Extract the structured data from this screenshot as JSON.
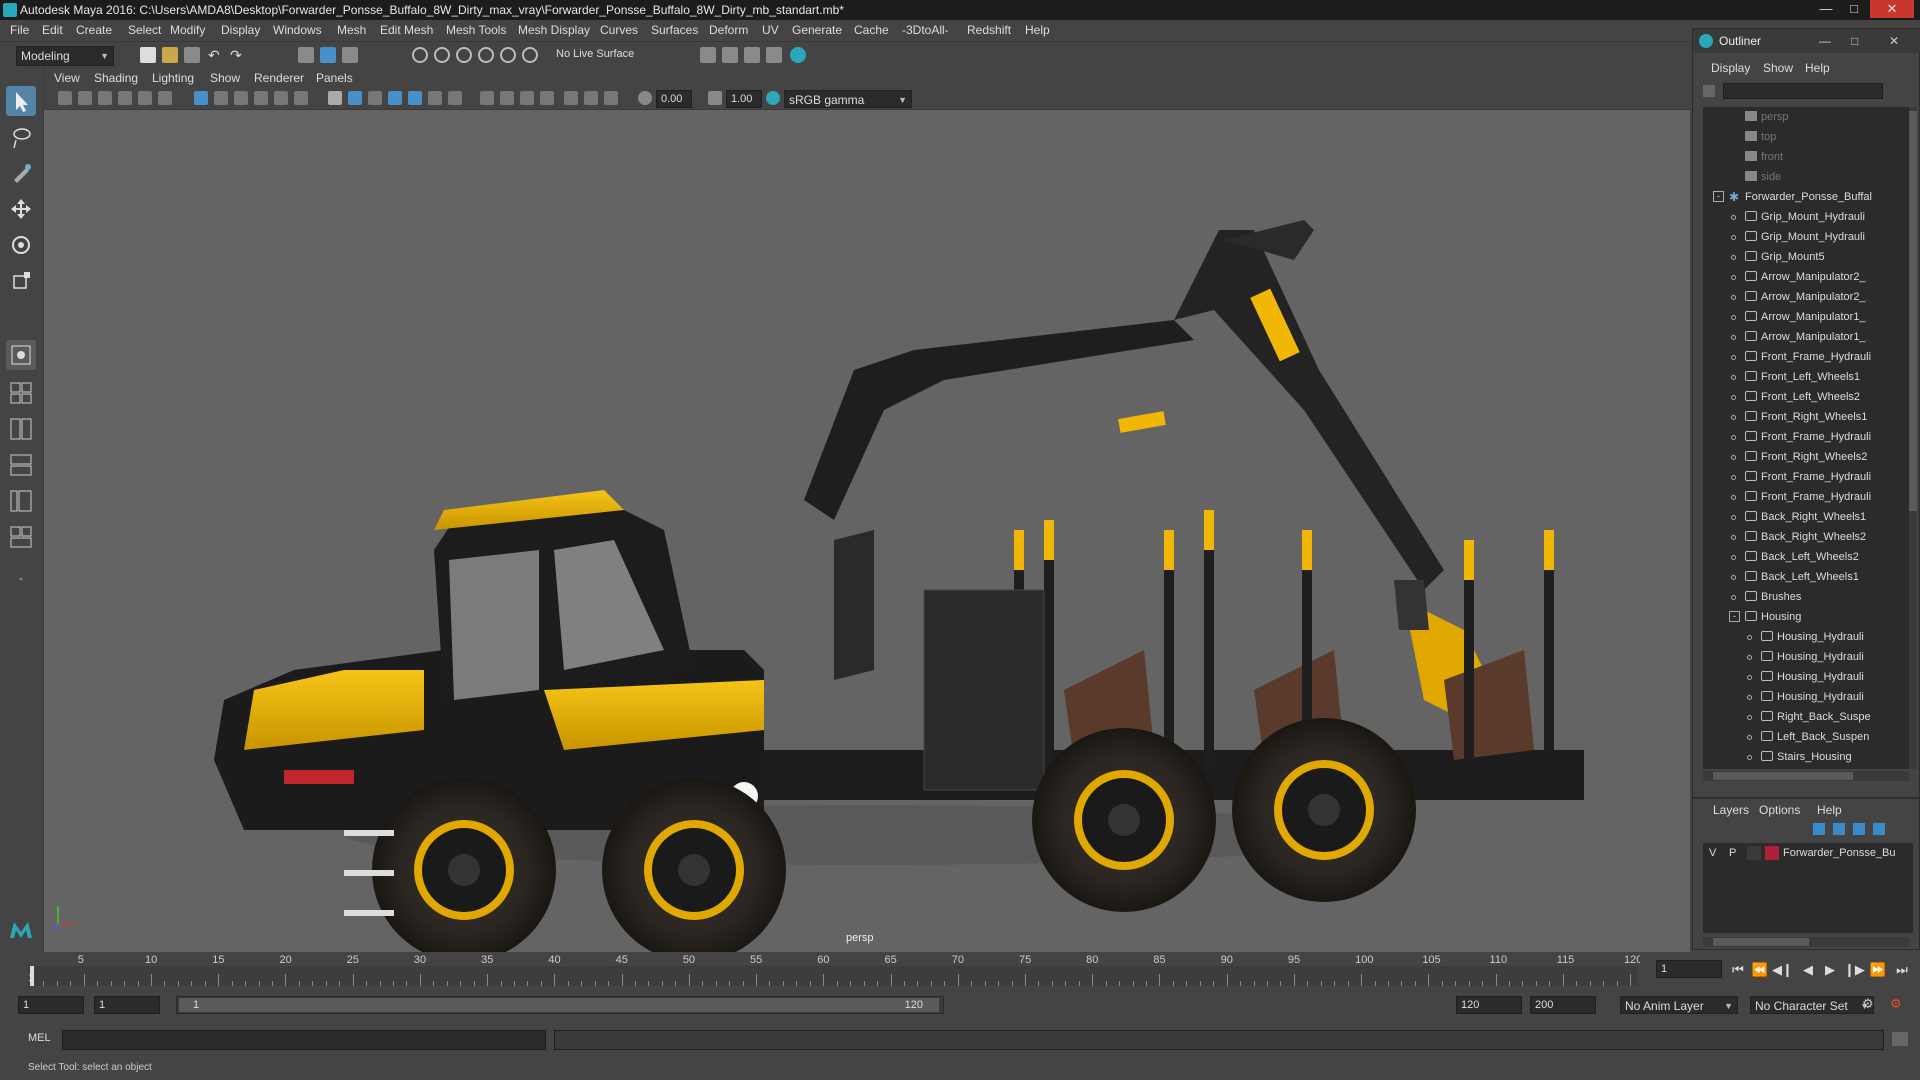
{
  "window": {
    "title": "Autodesk Maya 2016: C:\\Users\\AMDA8\\Desktop\\Forwarder_Ponsse_Buffalo_8W_Dirty_max_vray\\Forwarder_Ponsse_Buffalo_8W_Dirty_mb_standart.mb*"
  },
  "menubar": {
    "items": [
      "File",
      "Edit",
      "Create",
      "Select",
      "Modify",
      "Display",
      "Windows",
      "Mesh",
      "Edit Mesh",
      "Mesh Tools",
      "Mesh Display",
      "Curves",
      "Surfaces",
      "Deform",
      "UV",
      "Generate",
      "Cache",
      "-3DtoAll-",
      "Redshift",
      "Help"
    ]
  },
  "statusline": {
    "mode": "Modeling",
    "live_surface": "No Live Surface"
  },
  "viewport": {
    "menus": [
      "View",
      "Shading",
      "Lighting",
      "Show",
      "Renderer",
      "Panels"
    ],
    "exposure": "0.00",
    "gamma": "1.00",
    "color_space": "sRGB gamma",
    "camera_label": "persp"
  },
  "outliner": {
    "title": "Outliner",
    "menus": [
      "Display",
      "Show",
      "Help"
    ],
    "items": [
      {
        "label": "persp",
        "dim": true,
        "indent": 2
      },
      {
        "label": "top",
        "dim": true,
        "indent": 2
      },
      {
        "label": "front",
        "dim": true,
        "indent": 2
      },
      {
        "label": "side",
        "dim": true,
        "indent": 2
      },
      {
        "label": "Forwarder_Ponsse_Buffal",
        "dim": false,
        "indent": 1,
        "expand": "-"
      },
      {
        "label": "Grip_Mount_Hydrauli",
        "dim": false,
        "indent": 2
      },
      {
        "label": "Grip_Mount_Hydrauli",
        "dim": false,
        "indent": 2
      },
      {
        "label": "Grip_Mount5",
        "dim": false,
        "indent": 2
      },
      {
        "label": "Arrow_Manipulator2_",
        "dim": false,
        "indent": 2
      },
      {
        "label": "Arrow_Manipulator2_",
        "dim": false,
        "indent": 2
      },
      {
        "label": "Arrow_Manipulator1_",
        "dim": false,
        "indent": 2
      },
      {
        "label": "Arrow_Manipulator1_",
        "dim": false,
        "indent": 2
      },
      {
        "label": "Front_Frame_Hydrauli",
        "dim": false,
        "indent": 2
      },
      {
        "label": "Front_Left_Wheels1",
        "dim": false,
        "indent": 2
      },
      {
        "label": "Front_Left_Wheels2",
        "dim": false,
        "indent": 2
      },
      {
        "label": "Front_Right_Wheels1",
        "dim": false,
        "indent": 2
      },
      {
        "label": "Front_Frame_Hydrauli",
        "dim": false,
        "indent": 2
      },
      {
        "label": "Front_Right_Wheels2",
        "dim": false,
        "indent": 2
      },
      {
        "label": "Front_Frame_Hydrauli",
        "dim": false,
        "indent": 2
      },
      {
        "label": "Front_Frame_Hydrauli",
        "dim": false,
        "indent": 2
      },
      {
        "label": "Back_Right_Wheels1",
        "dim": false,
        "indent": 2
      },
      {
        "label": "Back_Right_Wheels2",
        "dim": false,
        "indent": 2
      },
      {
        "label": "Back_Left_Wheels2",
        "dim": false,
        "indent": 2
      },
      {
        "label": "Back_Left_Wheels1",
        "dim": false,
        "indent": 2
      },
      {
        "label": "Brushes",
        "dim": false,
        "indent": 2
      },
      {
        "label": "Housing",
        "dim": false,
        "indent": 2,
        "expand": "-"
      },
      {
        "label": "Housing_Hydrauli",
        "dim": false,
        "indent": 3
      },
      {
        "label": "Housing_Hydrauli",
        "dim": false,
        "indent": 3
      },
      {
        "label": "Housing_Hydrauli",
        "dim": false,
        "indent": 3
      },
      {
        "label": "Housing_Hydrauli",
        "dim": false,
        "indent": 3
      },
      {
        "label": "Right_Back_Suspe",
        "dim": false,
        "indent": 3
      },
      {
        "label": "Left_Back_Suspen",
        "dim": false,
        "indent": 3
      },
      {
        "label": "Stairs_Housing",
        "dim": false,
        "indent": 3
      }
    ]
  },
  "layers": {
    "menus": [
      "Layers",
      "Options",
      "Help"
    ],
    "layer": {
      "v": "V",
      "p": "P",
      "name": "Forwarder_Ponsse_Bu",
      "color": "#b0203a"
    }
  },
  "timeline": {
    "ticks": [
      "5",
      "10",
      "15",
      "20",
      "25",
      "30",
      "35",
      "40",
      "45",
      "50",
      "55",
      "60",
      "65",
      "70",
      "75",
      "80",
      "85",
      "90",
      "95",
      "100",
      "105",
      "110",
      "115",
      "120"
    ],
    "start_label": "1",
    "current_frame": "1",
    "current_time_fraction": 0.0
  },
  "range": {
    "start": "1",
    "inner_start": "1",
    "slider_start": "1",
    "slider_end": "120",
    "inner_end": "120",
    "end": "200",
    "anim_layer": "No Anim Layer",
    "character_set": "No Character Set"
  },
  "commandline": {
    "label": "MEL"
  },
  "helpline": {
    "text": "Select Tool: select an object"
  },
  "colors": {
    "machine_yellow": "#f2b705",
    "machine_black": "#1b1b1b",
    "viewport_bg": "#646464",
    "highlight_blue": "#4a90c8"
  }
}
